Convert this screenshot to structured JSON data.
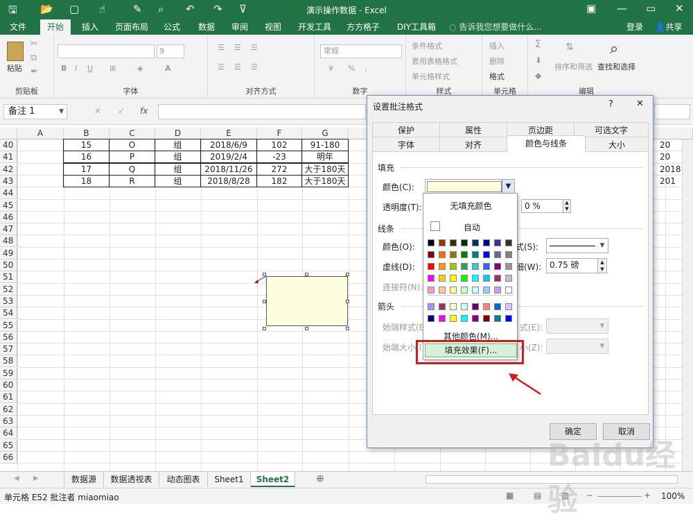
{
  "title": "演示操作数据 - Excel",
  "ribbon_tabs": [
    "文件",
    "开始",
    "插入",
    "页面布局",
    "公式",
    "数据",
    "审阅",
    "视图",
    "开发工具",
    "方方格子",
    "DIY工具箱"
  ],
  "active_tab": "开始",
  "tell_me": "告诉我您想要做什么...",
  "login": "登录",
  "share": "共享",
  "groups": {
    "clipboard": "剪贴板",
    "paste": "粘贴",
    "font": "字体",
    "font_size": "9",
    "align": "对齐方式",
    "number": "数字",
    "number_format": "常规",
    "styles": "样式",
    "cond_format": "条件格式",
    "table_format": "套用表格格式",
    "cell_style": "单元格样式",
    "cells": "单元格",
    "insert": "插入",
    "delete": "删除",
    "format": "格式",
    "editing": "编辑",
    "sort_filter": "排序和筛选",
    "find_select": "查找和选择"
  },
  "name_box": "备注 1",
  "fx": "fx",
  "columns": [
    "A",
    "B",
    "C",
    "D",
    "E",
    "F",
    "G"
  ],
  "right_col_partial": [
    "20",
    "20",
    "2018",
    "201"
  ],
  "rows": [
    "40",
    "41",
    "42",
    "43",
    "44",
    "45",
    "46",
    "47",
    "48",
    "49",
    "50",
    "51",
    "52",
    "53",
    "54",
    "55",
    "56",
    "57",
    "58",
    "59",
    "60",
    "61",
    "62",
    "63",
    "64",
    "65",
    "66"
  ],
  "table": [
    [
      "15",
      "O",
      "组",
      "2018/6/9",
      "102",
      "91-180"
    ],
    [
      "16",
      "P",
      "组",
      "2019/2/4",
      "-23",
      "明年"
    ],
    [
      "17",
      "Q",
      "组",
      "2018/11/26",
      "272",
      "大于180天"
    ],
    [
      "18",
      "R",
      "组",
      "2018/8/28",
      "182",
      "大于180天"
    ]
  ],
  "sheet_tabs": [
    "数据源",
    "数据透视表",
    "动态图表",
    "Sheet1",
    "Sheet2"
  ],
  "active_sheet": "Sheet2",
  "status": "单元格 E52 批注者 miaomiao",
  "zoom": "100%",
  "dialog": {
    "title": "设置批注格式",
    "help": "?",
    "close": "✕",
    "tabs_row1": [
      "保护",
      "属性",
      "页边距",
      "可选文字"
    ],
    "tabs_row2": [
      "字体",
      "对齐",
      "颜色与线条",
      "大小"
    ],
    "active_tab": "颜色与线条",
    "fill_section": "填充",
    "fill_color_label": "颜色(C):",
    "fill_color_value": "#fdfde0",
    "transparency_label": "透明度(T):",
    "transparency_value": "0 %",
    "line_section": "线条",
    "line_color_label": "颜色(O):",
    "dash_label": "虚线(D):",
    "connector_label": "连接符(N):",
    "style_label_partial": "式(S):",
    "weight_label_partial": "细(W):",
    "weight_value": "0.75 磅",
    "arrow_section": "箭头",
    "begin_style_label": "始端样式(B):",
    "end_style_label_partial": "式(E):",
    "begin_size_label": "始端大小(I):",
    "end_size_label_partial": "小(Z):",
    "ok": "确定",
    "cancel": "取消"
  },
  "palette": {
    "no_fill": "无填充颜色",
    "auto": "自动",
    "more_colors": "其他颜色(M)...",
    "fill_effects": "填充效果(F)...",
    "rows": [
      [
        "#000000",
        "#993300",
        "#333300",
        "#003300",
        "#003366",
        "#000080",
        "#333399",
        "#333333"
      ],
      [
        "#800000",
        "#ff6600",
        "#808000",
        "#008000",
        "#008080",
        "#0000ff",
        "#666699",
        "#808080"
      ],
      [
        "#ff0000",
        "#ff9900",
        "#99cc00",
        "#339966",
        "#33cccc",
        "#3366ff",
        "#800080",
        "#969696"
      ],
      [
        "#ff00ff",
        "#ffcc00",
        "#ffff00",
        "#00ff00",
        "#00ffff",
        "#00ccff",
        "#993366",
        "#c0c0c0"
      ],
      [
        "#ff99cc",
        "#ffcc99",
        "#ffff99",
        "#ccffcc",
        "#ccffff",
        "#99ccff",
        "#cc99ff",
        "#ffffff"
      ],
      [
        "#9999ff",
        "#993366",
        "#ffffcc",
        "#ccffff",
        "#660066",
        "#ff8080",
        "#0066cc",
        "#ccccff"
      ],
      [
        "#000080",
        "#ff00ff",
        "#ffff00",
        "#00ffff",
        "#800080",
        "#800000",
        "#008080",
        "#0000ff"
      ]
    ]
  },
  "watermark": "Baidu经验"
}
